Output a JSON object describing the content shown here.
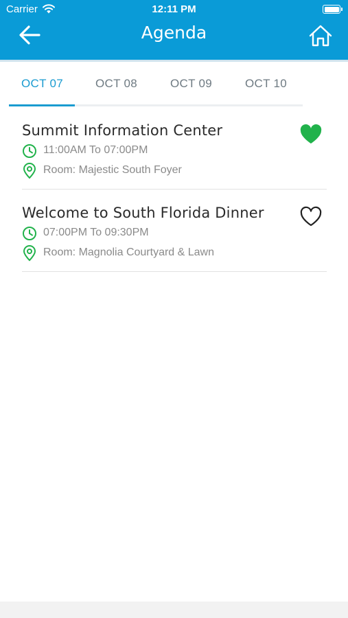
{
  "status_bar": {
    "carrier": "Carrier",
    "time": "12:11 PM"
  },
  "nav": {
    "title": "Agenda",
    "back_icon": "arrow-left-icon",
    "home_icon": "home-icon"
  },
  "tabs": [
    {
      "label": "OCT 07",
      "active": true
    },
    {
      "label": "OCT 08",
      "active": false
    },
    {
      "label": "OCT 09",
      "active": false
    },
    {
      "label": "OCT 10",
      "active": false
    }
  ],
  "agenda_items": [
    {
      "title": "Summit Information Center",
      "time": "11:00AM To 07:00PM",
      "room": "Room: Majestic South Foyer",
      "favorited": true
    },
    {
      "title": "Welcome to South Florida Dinner",
      "time": "07:00PM To 09:30PM",
      "room": "Room: Magnolia Courtyard & Lawn",
      "favorited": false
    }
  ],
  "colors": {
    "header": "#0a9bd7",
    "accent": "#1a9bd0",
    "green": "#21b24b",
    "text": "#2a2a2a",
    "muted": "#8a8a8a"
  }
}
